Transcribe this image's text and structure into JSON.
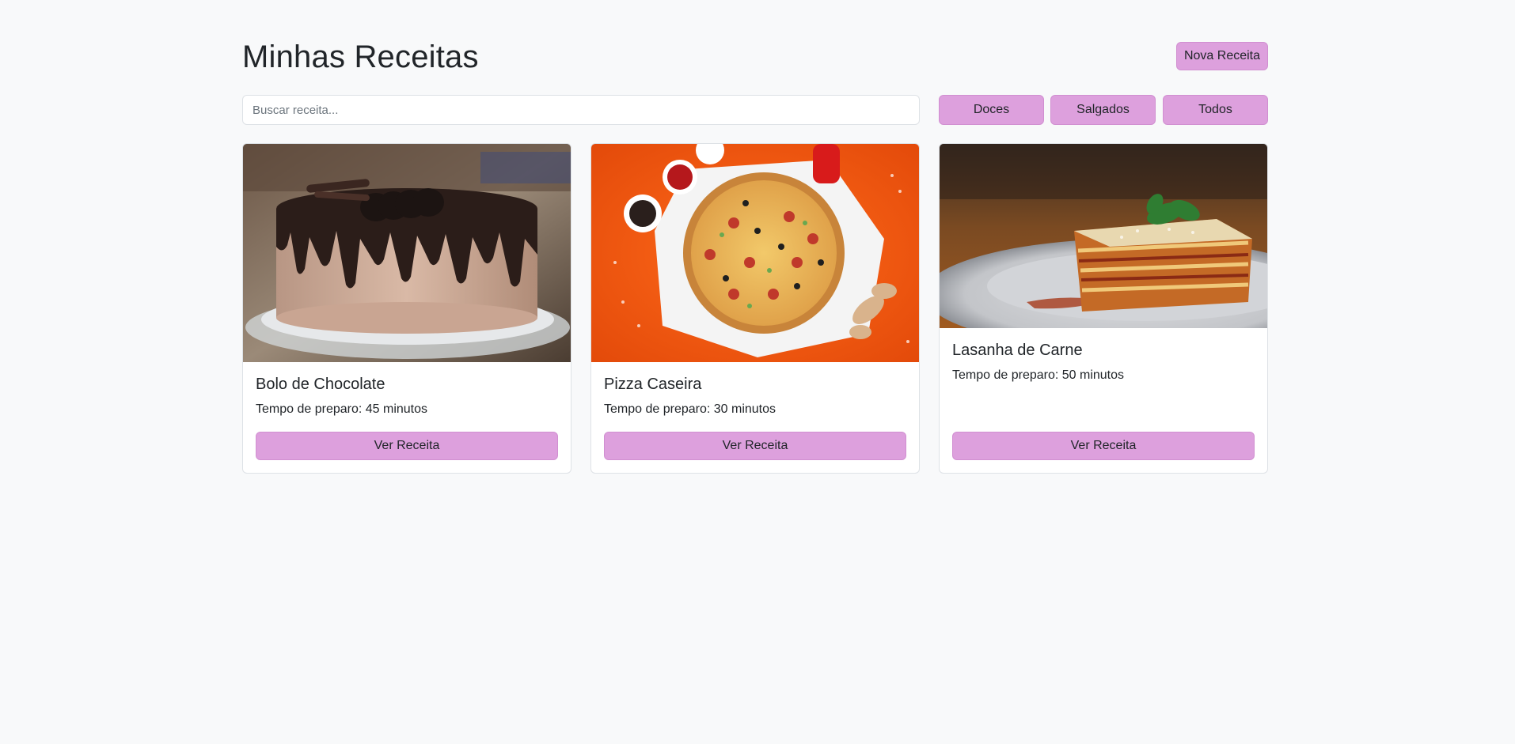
{
  "header": {
    "title": "Minhas Receitas",
    "new_button": "Nova Receita"
  },
  "search": {
    "placeholder": "Buscar receita...",
    "value": ""
  },
  "filters": [
    "Doces",
    "Salgados",
    "Todos"
  ],
  "recipes": [
    {
      "title": "Bolo de Chocolate",
      "text": "Tempo de preparo: 45 minutos",
      "button": "Ver Receita",
      "image": "chocolate-cake-photo"
    },
    {
      "title": "Pizza Caseira",
      "text": "Tempo de preparo: 30 minutos",
      "button": "Ver Receita",
      "image": "pizza-photo"
    },
    {
      "title": "Lasanha de Carne",
      "text": "Tempo de preparo: 50 minutos",
      "button": "Ver Receita",
      "image": "lasagna-photo"
    }
  ],
  "colors": {
    "background": "#f8f9fa",
    "accent": "#dda0dd",
    "card_border": "#dee2e6"
  }
}
